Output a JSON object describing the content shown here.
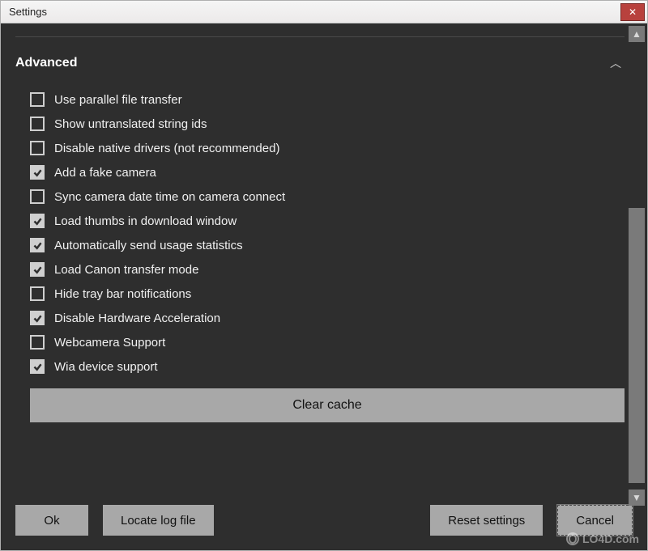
{
  "window": {
    "title": "Settings"
  },
  "section": {
    "title": "Advanced"
  },
  "options": [
    {
      "label": "Use parallel file transfer",
      "checked": false
    },
    {
      "label": "Show untranslated string ids",
      "checked": false
    },
    {
      "label": "Disable native drivers (not recommended)",
      "checked": false
    },
    {
      "label": "Add a fake camera",
      "checked": true
    },
    {
      "label": "Sync camera date time on camera connect",
      "checked": false
    },
    {
      "label": "Load thumbs in download window",
      "checked": true
    },
    {
      "label": "Automatically send usage statistics",
      "checked": true
    },
    {
      "label": "Load Canon transfer mode",
      "checked": true
    },
    {
      "label": "Hide tray bar notifications",
      "checked": false
    },
    {
      "label": "Disable Hardware Acceleration",
      "checked": true
    },
    {
      "label": "Webcamera Support",
      "checked": false
    },
    {
      "label": "Wia device support",
      "checked": true
    }
  ],
  "buttons": {
    "clear_cache": "Clear cache",
    "ok": "Ok",
    "locate_log": "Locate log file",
    "reset": "Reset settings",
    "cancel": "Cancel"
  },
  "watermark": "LO4D.com"
}
